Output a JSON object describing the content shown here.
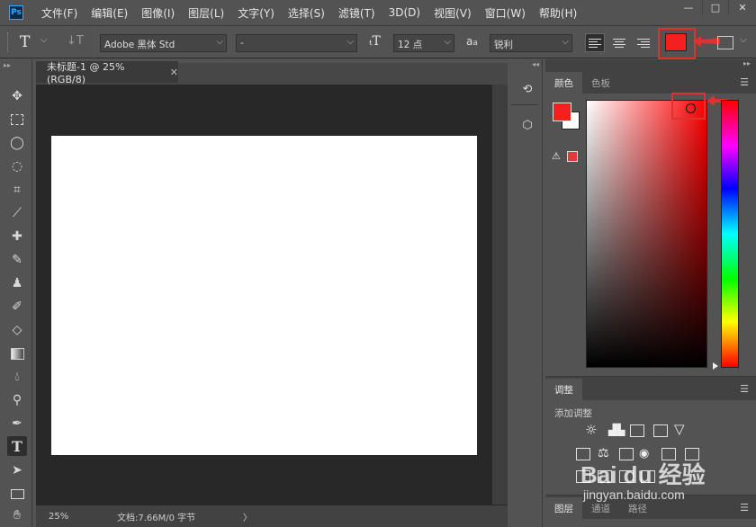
{
  "menubar": {
    "logo": "Ps",
    "items": [
      "文件(F)",
      "编辑(E)",
      "图像(I)",
      "图层(L)",
      "文字(Y)",
      "选择(S)",
      "滤镜(T)",
      "3D(D)",
      "视图(V)",
      "窗口(W)",
      "帮助(H)"
    ],
    "window_buttons": [
      "—",
      "□",
      "✕"
    ]
  },
  "options": {
    "font_family": "Adobe 黑体 Std",
    "font_style": "-",
    "font_size": "12 点",
    "aa_label": "a",
    "antialias": "锐利",
    "text_color": "#f42020"
  },
  "document": {
    "tab_title": "未标题-1 @ 25%(RGB/8)",
    "tab_close": "✕",
    "zoom": "25%",
    "status": "文档:7.66M/0 字节",
    "status_arrow": "〉"
  },
  "color_panel": {
    "tabs": [
      "颜色",
      "色板"
    ],
    "foreground": "#f42020",
    "background": "#ffffff",
    "gamut_color": "#e03a3a"
  },
  "adjust_panel": {
    "tabs": [
      "调整"
    ],
    "add_label": "添加调整"
  },
  "layers_panel": {
    "tabs": [
      "图层",
      "通道",
      "路径"
    ]
  },
  "watermark": {
    "brand": "Bai du 经验",
    "url": "jingyan.baidu.com"
  }
}
